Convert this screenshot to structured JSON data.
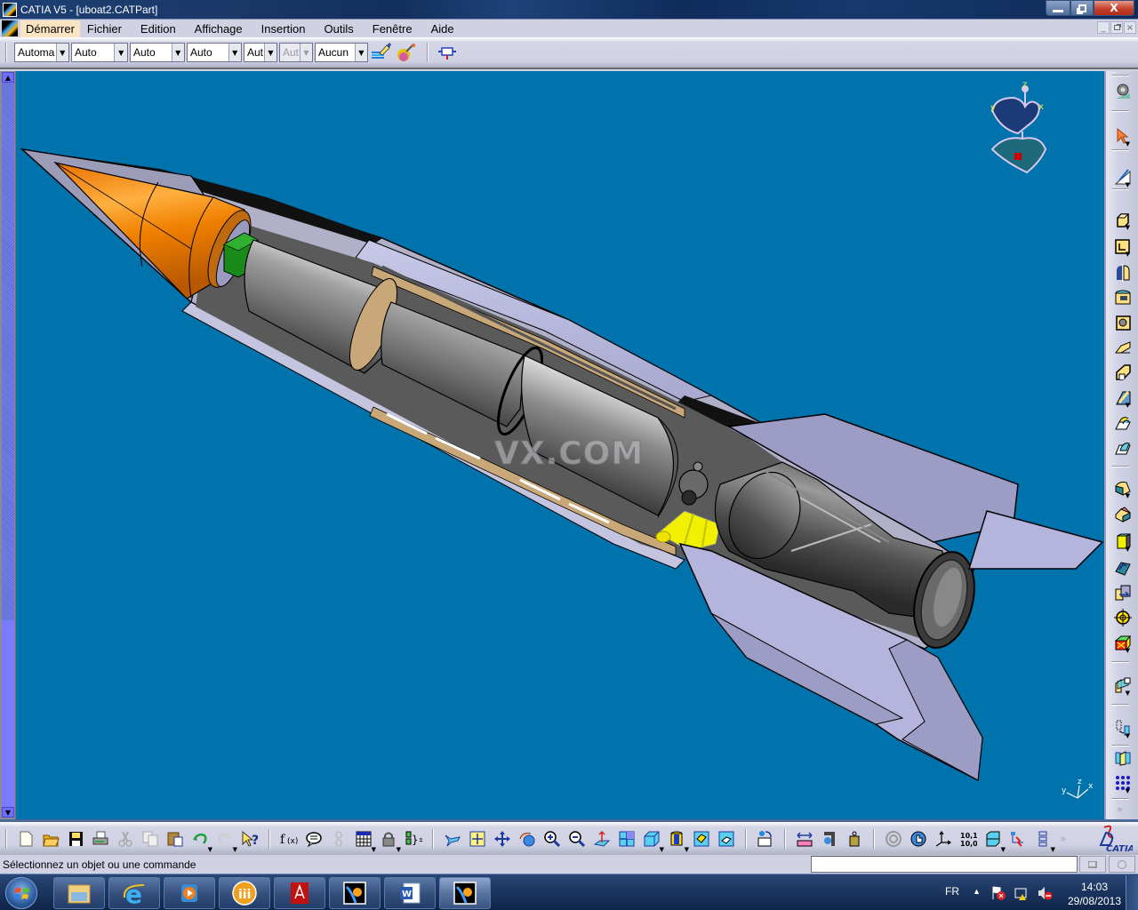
{
  "window": {
    "title": "CATIA V5 - [uboat2.CATPart]",
    "controls": {
      "minimize": "—",
      "maximize": "⧉",
      "close": "X"
    }
  },
  "menubar": {
    "items": [
      {
        "label": "Démarrer",
        "active": true
      },
      {
        "label": "Fichier"
      },
      {
        "label": "Edition"
      },
      {
        "label": "Affichage"
      },
      {
        "label": "Insertion"
      },
      {
        "label": "Outils"
      },
      {
        "label": "Fenêtre"
      },
      {
        "label": "Aide"
      }
    ],
    "mdi": {
      "minimize": "_",
      "restore": "б",
      "close": "×"
    }
  },
  "graphic_properties_toolbar": {
    "combos": [
      {
        "name": "fill-color",
        "value": "Automa"
      },
      {
        "name": "line-color",
        "value": "Auto"
      },
      {
        "name": "transparency",
        "value": "Auto"
      },
      {
        "name": "line-thickness",
        "value": "Auto"
      },
      {
        "name": "line-type",
        "value": "Aut"
      },
      {
        "name": "point-symbol",
        "value": "Aut",
        "disabled": true
      },
      {
        "name": "rendering-style",
        "value": "Aucun"
      }
    ],
    "icons": [
      "painter-brush-icon",
      "copy-format-icon",
      "view-mode-icon"
    ]
  },
  "viewport": {
    "background": "#0072ac",
    "model": "V2 rocket cutaway (uboat2.CATPart)",
    "watermark": "VX.COM",
    "compass_labels": {
      "x": "x",
      "y": "y",
      "z": "z"
    },
    "axis_labels": {
      "x": "x",
      "y": "y",
      "z": "z"
    }
  },
  "right_toolbar": {
    "icons": [
      "sketcher-gear-icon",
      "select-arrow-icon",
      "sketch-icon",
      "pad-icon",
      "pocket-icon",
      "shaft-icon",
      "groove-icon",
      "hole-icon",
      "rib-icon",
      "slot-icon",
      "stiffener-icon",
      "multi-sections-solid-icon",
      "removed-multi-sections-icon",
      "edge-fillet-icon",
      "chamfer-icon",
      "draft-icon",
      "shell-icon",
      "thickness-icon",
      "thread-icon",
      "remove-face-icon",
      "split-icon",
      "translation-icon",
      "mirror-icon",
      "rectangular-pattern-icon"
    ]
  },
  "bottom_toolbar": {
    "groups": [
      [
        "new-icon",
        "open-icon",
        "save-icon",
        "print-icon",
        "cut-icon",
        "copy-icon",
        "paste-icon",
        "undo-icon",
        "redo-icon",
        "whats-this-icon"
      ],
      [
        "formula-icon",
        "comment-icon",
        "link-icon",
        "table-icon",
        "lock-icon",
        "equation-icon"
      ],
      [
        "fly-mode-icon",
        "fit-all-icon",
        "pan-icon",
        "rotate-icon",
        "zoom-in-icon",
        "zoom-out-icon",
        "normal-view-icon",
        "multi-view-icon",
        "iso-view-icon",
        "shading-icon",
        "hide-show-icon",
        "swap-visible-icon"
      ],
      [
        "update-icon"
      ],
      [
        "measure-between-icon",
        "measure-item-icon",
        "measure-inertia-icon"
      ],
      [
        "catalog-browser-icon",
        "manipulation-icon",
        "axis-system-icon",
        "analysis-icon",
        "3d-annotation-icon",
        "connect-checker-icon",
        "tree-icon"
      ]
    ],
    "overflow": "»",
    "brand": "CATIA"
  },
  "statusbar": {
    "message": "Sélectionnez un objet ou une commande",
    "command_input": ""
  },
  "taskbar": {
    "apps": [
      "start-orb",
      "windows-explorer",
      "internet-explorer",
      "media-player",
      "lotus-symphony",
      "adobe-reader",
      "catia-1",
      "microsoft-word",
      "catia-2"
    ],
    "language": "FR",
    "time": "14:03",
    "date": "29/08/2013"
  }
}
